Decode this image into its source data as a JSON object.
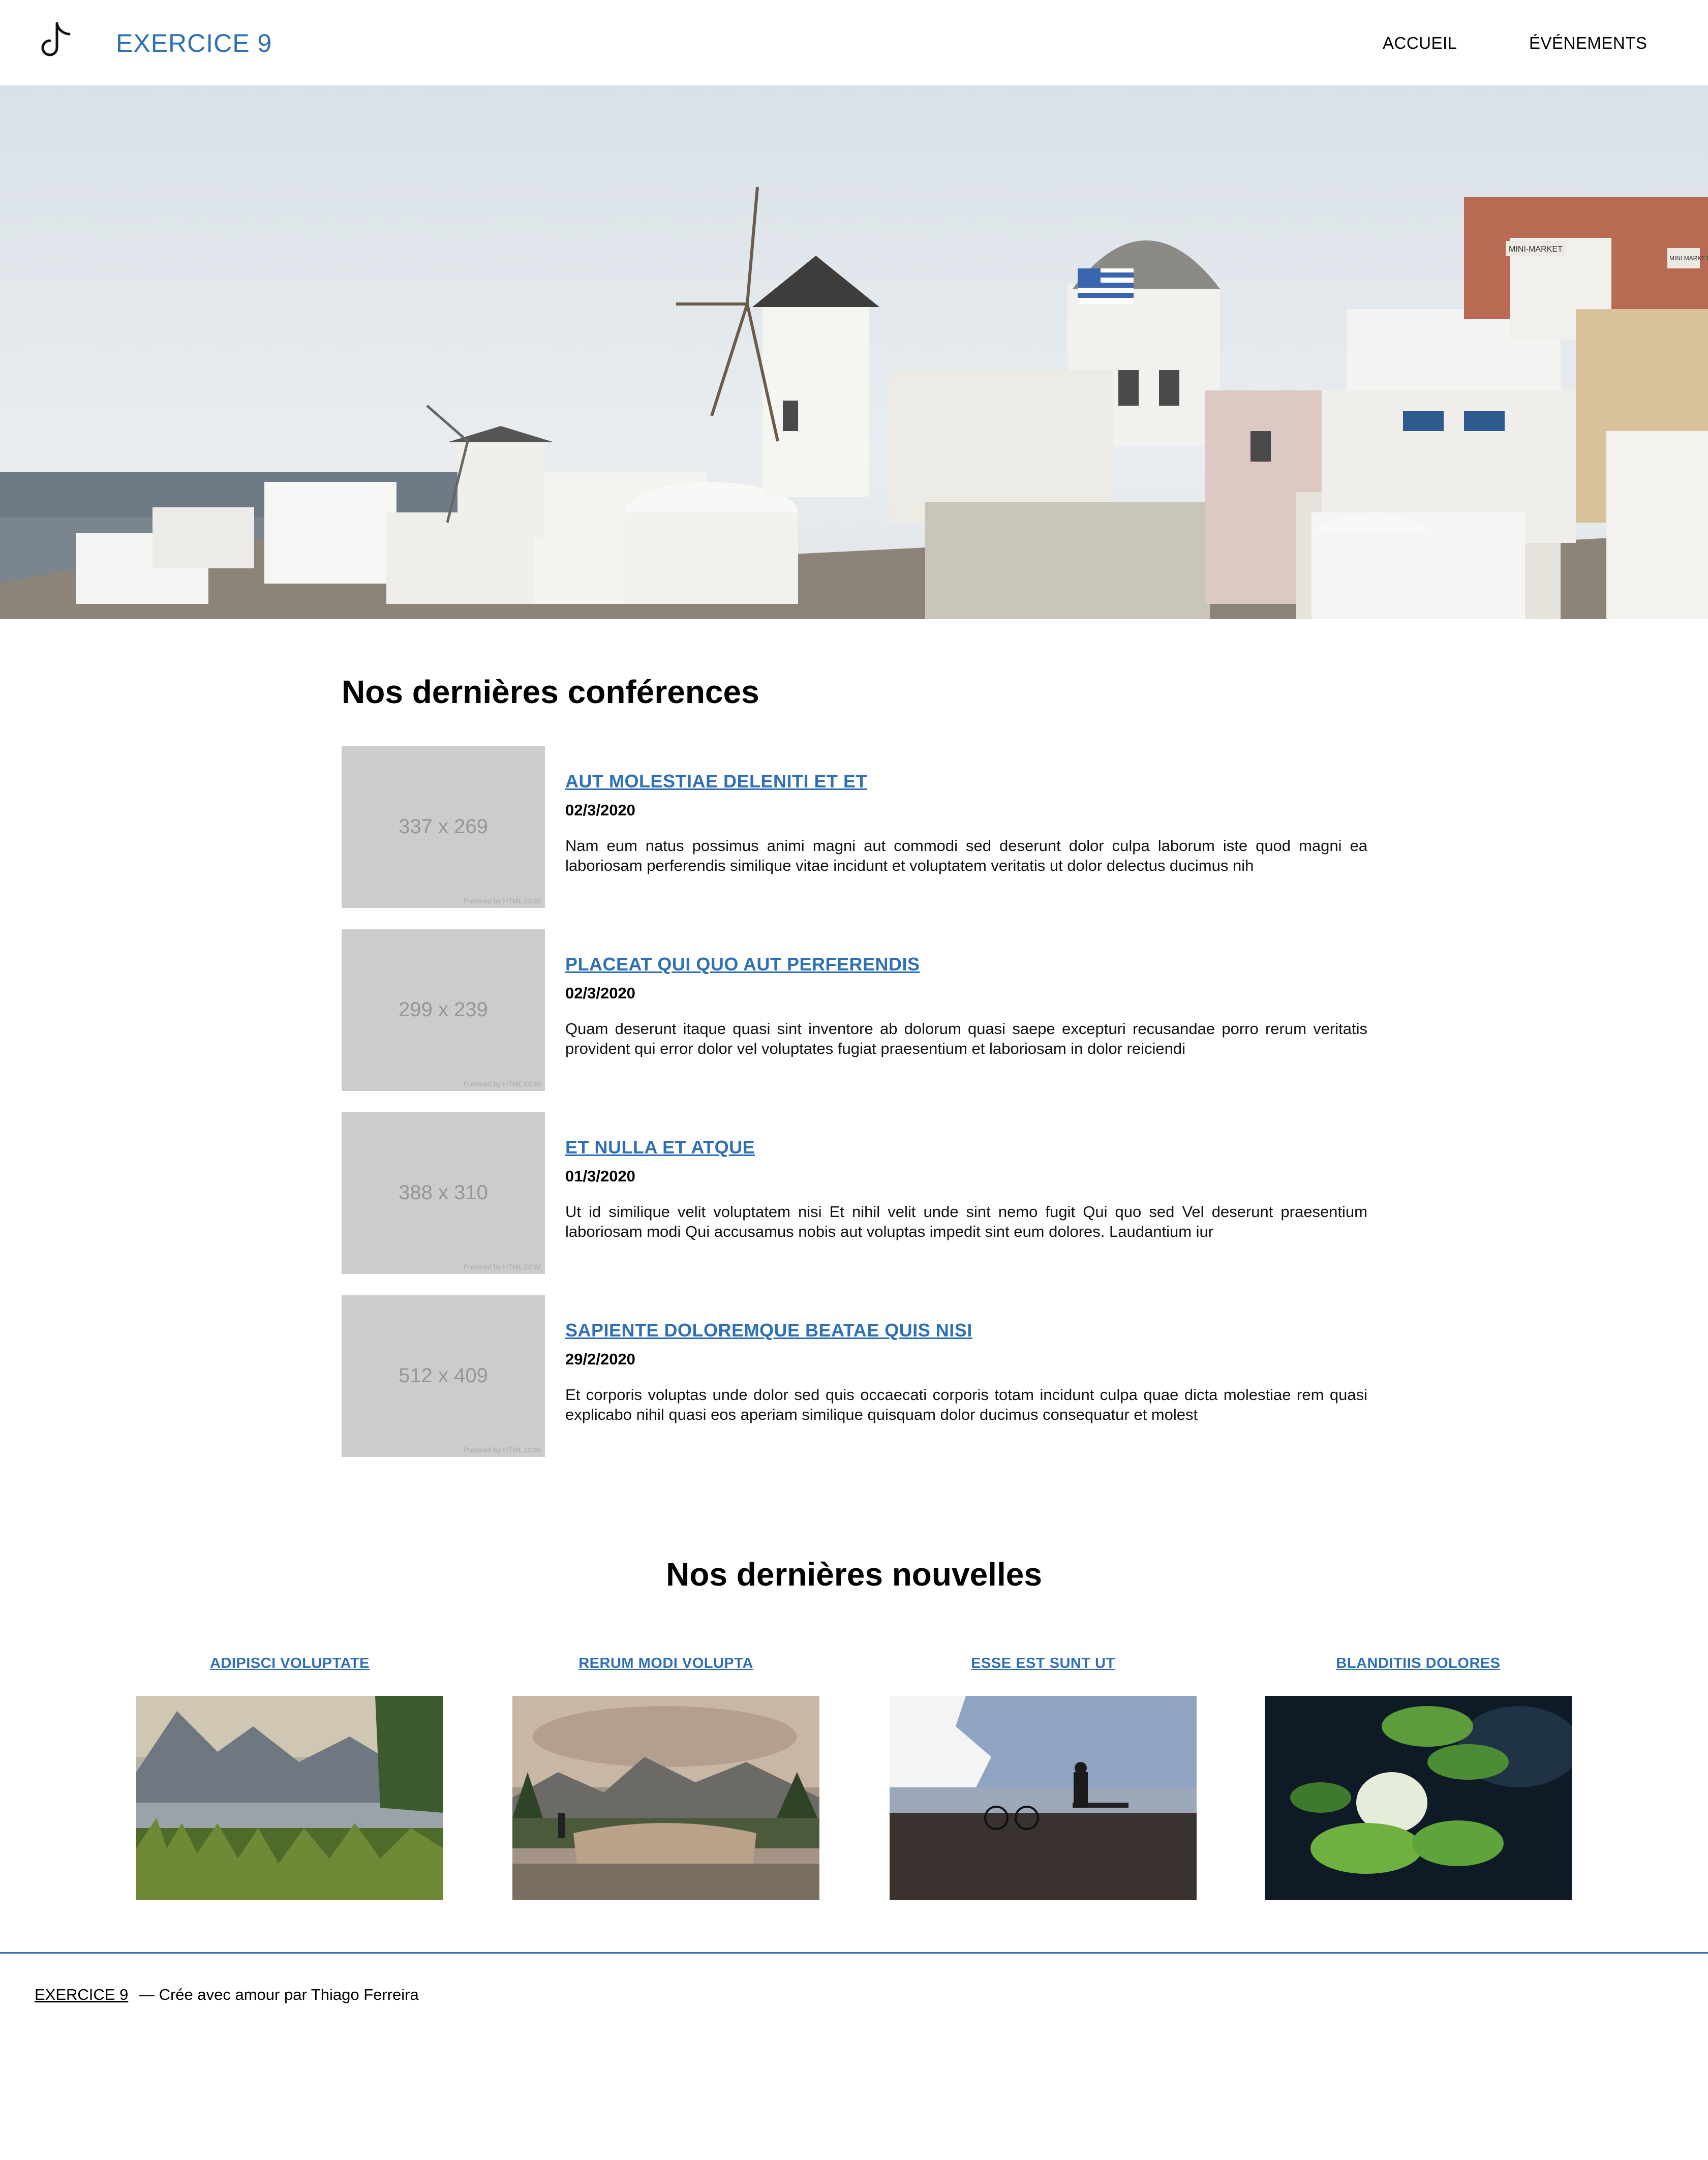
{
  "header": {
    "site_title": "EXERCICE 9",
    "nav": [
      {
        "label": "ACCUEIL"
      },
      {
        "label": "ÉVÉNEMENTS"
      }
    ]
  },
  "conferences": {
    "title": "Nos dernières conférences",
    "items": [
      {
        "image_label": "337 x 269",
        "image_credit": "Powered by HTML.COM",
        "title": "AUT MOLESTIAE DELENITI ET ET",
        "date": "02/3/2020",
        "description": "Nam eum natus possimus animi magni aut commodi sed deserunt dolor culpa laborum iste quod magni ea laboriosam perferendis similique vitae incidunt et voluptatem veritatis ut dolor delectus ducimus nih"
      },
      {
        "image_label": "299 x 239",
        "image_credit": "Powered by HTML.COM",
        "title": "PLACEAT QUI QUO AUT PERFERENDIS",
        "date": "02/3/2020",
        "description": "Quam deserunt itaque quasi sint inventore ab dolorum quasi saepe excepturi recusandae porro rerum veritatis provident qui error dolor vel voluptates fugiat praesentium et laboriosam in dolor reiciendi"
      },
      {
        "image_label": "388 x 310",
        "image_credit": "Powered by HTML.COM",
        "title": "ET NULLA ET ATQUE",
        "date": "01/3/2020",
        "description": "Ut id similique velit voluptatem nisi Et nihil velit unde sint nemo fugit Qui quo sed Vel deserunt praesentium laboriosam modi Qui accusamus nobis aut voluptas impedit sint eum dolores. Laudantium iur"
      },
      {
        "image_label": "512 x 409",
        "image_credit": "Powered by HTML.COM",
        "title": "SAPIENTE DOLOREMQUE BEATAE QUIS NISI",
        "date": "29/2/2020",
        "description": "Et corporis voluptas unde dolor sed quis occaecati corporis totam incidunt culpa quae dicta molestiae rem quasi explicabo nihil quasi eos aperiam similique quisquam dolor ducimus consequatur et molest"
      }
    ]
  },
  "news": {
    "title": "Nos dernières nouvelles",
    "items": [
      {
        "title": "ADIPISCI VOLUPTATE"
      },
      {
        "title": "RERUM MODI VOLUPTA"
      },
      {
        "title": "ESSE EST SUNT UT"
      },
      {
        "title": "BLANDITIIS DOLORES"
      }
    ]
  },
  "hero": {
    "sign_1": "MINI-MARKET",
    "sign_2": "MINI MARKET"
  },
  "footer": {
    "site_link": "EXERCICE 9",
    "credit": "— Crée avec amour par Thiago Ferreira"
  },
  "colors": {
    "accent": "#2e6fb5",
    "placeholder": "#cccccc"
  },
  "icons": {
    "logo": "tiktok-note-icon"
  }
}
